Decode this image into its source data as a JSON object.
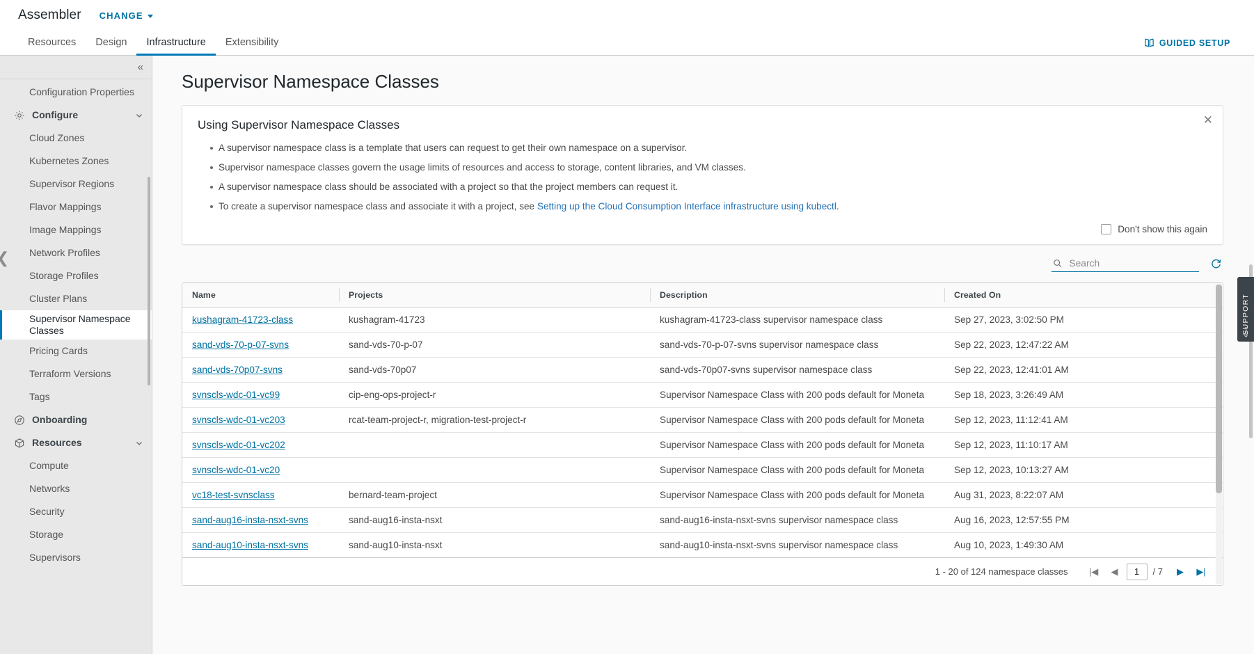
{
  "app": {
    "brand": "Assembler",
    "change_label": "CHANGE",
    "guided_setup": "GUIDED SETUP",
    "support_tab": "SUPPORT"
  },
  "nav": {
    "tabs": [
      {
        "label": "Resources",
        "active": false
      },
      {
        "label": "Design",
        "active": false
      },
      {
        "label": "Infrastructure",
        "active": true
      },
      {
        "label": "Extensibility",
        "active": false
      }
    ]
  },
  "sidebar": {
    "items": [
      {
        "label": "Configuration Properties",
        "type": "item"
      },
      {
        "label": "Configure",
        "type": "group",
        "icon": "gear-icon",
        "expanded": true
      },
      {
        "label": "Cloud Zones",
        "type": "item"
      },
      {
        "label": "Kubernetes Zones",
        "type": "item"
      },
      {
        "label": "Supervisor Regions",
        "type": "item"
      },
      {
        "label": "Flavor Mappings",
        "type": "item"
      },
      {
        "label": "Image Mappings",
        "type": "item"
      },
      {
        "label": "Network Profiles",
        "type": "item"
      },
      {
        "label": "Storage Profiles",
        "type": "item"
      },
      {
        "label": "Cluster Plans",
        "type": "item"
      },
      {
        "label": "Supervisor Namespace Classes",
        "type": "item",
        "active": true
      },
      {
        "label": "Pricing Cards",
        "type": "item"
      },
      {
        "label": "Terraform Versions",
        "type": "item"
      },
      {
        "label": "Tags",
        "type": "item"
      },
      {
        "label": "Onboarding",
        "type": "group",
        "icon": "compass-icon",
        "expanded": false
      },
      {
        "label": "Resources",
        "type": "group",
        "icon": "cube-icon",
        "expanded": true
      },
      {
        "label": "Compute",
        "type": "item"
      },
      {
        "label": "Networks",
        "type": "item"
      },
      {
        "label": "Security",
        "type": "item"
      },
      {
        "label": "Storage",
        "type": "item"
      },
      {
        "label": "Supervisors",
        "type": "item"
      }
    ]
  },
  "page": {
    "title": "Supervisor Namespace Classes"
  },
  "info_card": {
    "title": "Using Supervisor Namespace Classes",
    "bullets": [
      "A supervisor namespace class is a template that users can request to get their own namespace on a supervisor.",
      "Supervisor namespace classes govern the usage limits of resources and access to storage, content libraries, and VM classes.",
      "A supervisor namespace class should be associated with a project so that the project members can request it."
    ],
    "bullet_link": {
      "prefix": "To create a supervisor namespace class and associate it with a project, see ",
      "link_text": "Setting up the Cloud Consumption Interface infrastructure using kubectl",
      "suffix": "."
    },
    "dont_show_label": "Don't show this again",
    "close_icon": "close-icon"
  },
  "toolbar": {
    "search_placeholder": "Search",
    "search_value": "",
    "search_icon": "search-icon",
    "refresh_icon": "refresh-icon"
  },
  "table": {
    "columns": [
      "Name",
      "Projects",
      "Description",
      "Created On"
    ],
    "rows": [
      {
        "name": "kushagram-41723-class",
        "projects": "kushagram-41723",
        "description": "kushagram-41723-class supervisor namespace class",
        "created_on": "Sep 27, 2023, 3:02:50 PM"
      },
      {
        "name": "sand-vds-70-p-07-svns",
        "projects": "sand-vds-70-p-07",
        "description": "sand-vds-70-p-07-svns supervisor namespace class",
        "created_on": "Sep 22, 2023, 12:47:22 AM"
      },
      {
        "name": "sand-vds-70p07-svns",
        "projects": "sand-vds-70p07",
        "description": "sand-vds-70p07-svns supervisor namespace class",
        "created_on": "Sep 22, 2023, 12:41:01 AM"
      },
      {
        "name": "svnscls-wdc-01-vc99",
        "projects": "cip-eng-ops-project-r",
        "description": "Supervisor Namespace Class with 200 pods default for Moneta",
        "created_on": "Sep 18, 2023, 3:26:49 AM"
      },
      {
        "name": "svnscls-wdc-01-vc203",
        "projects": "rcat-team-project-r, migration-test-project-r",
        "description": "Supervisor Namespace Class with 200 pods default for Moneta",
        "created_on": "Sep 12, 2023, 11:12:41 AM"
      },
      {
        "name": "svnscls-wdc-01-vc202",
        "projects": "",
        "description": "Supervisor Namespace Class with 200 pods default for Moneta",
        "created_on": "Sep 12, 2023, 11:10:17 AM"
      },
      {
        "name": "svnscls-wdc-01-vc20",
        "projects": "",
        "description": "Supervisor Namespace Class with 200 pods default for Moneta",
        "created_on": "Sep 12, 2023, 10:13:27 AM"
      },
      {
        "name": "vc18-test-svnsclass",
        "projects": "bernard-team-project",
        "description": "Supervisor Namespace Class with 200 pods default for Moneta",
        "created_on": "Aug 31, 2023, 8:22:07 AM"
      },
      {
        "name": "sand-aug16-insta-nsxt-svns",
        "projects": "sand-aug16-insta-nsxt",
        "description": "sand-aug16-insta-nsxt-svns supervisor namespace class",
        "created_on": "Aug 16, 2023, 12:57:55 PM"
      },
      {
        "name": "sand-aug10-insta-nsxt-svns",
        "projects": "sand-aug10-insta-nsxt",
        "description": "sand-aug10-insta-nsxt-svns supervisor namespace class",
        "created_on": "Aug 10, 2023, 1:49:30 AM"
      }
    ]
  },
  "pagination": {
    "summary": "1 - 20 of 124 namespace classes",
    "first_icon": "first-page-icon",
    "prev_icon": "prev-page-icon",
    "current_page": "1",
    "total_pages": "/ 7",
    "next_icon": "next-page-icon",
    "last_icon": "last-page-icon"
  },
  "colors": {
    "accent": "#0072a3",
    "active_tab": "#0079b8",
    "link": "#2372b8",
    "sidebar_bg": "#e8e8e8"
  }
}
